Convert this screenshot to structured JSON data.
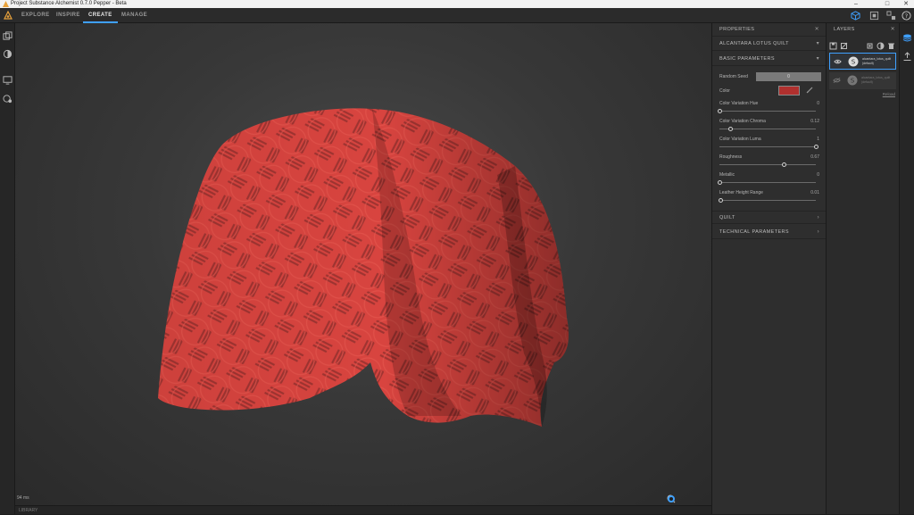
{
  "window": {
    "title": "Project Substance Alchemist 0.7.0 Pepper - Beta",
    "controls": [
      "–",
      "□",
      "✕"
    ]
  },
  "nav": {
    "tabs": [
      {
        "label": "EXPLORE",
        "active": false
      },
      {
        "label": "INSPIRE",
        "active": false
      },
      {
        "label": "CREATE",
        "active": true
      },
      {
        "label": "MANAGE",
        "active": false
      }
    ],
    "accent": "#3fa0ff"
  },
  "viewport": {
    "fps": "94 ms",
    "material_color": "#d8443f"
  },
  "library": {
    "label": "LIBRARY"
  },
  "properties": {
    "title": "PROPERTIES",
    "material_name": "ALCANTARA LOTUS QUILT",
    "sections": {
      "basic": "BASIC PARAMETERS",
      "quilt": "QUILT",
      "technical": "TECHNICAL PARAMETERS"
    },
    "random_seed": {
      "label": "Random Seed",
      "value": "0"
    },
    "color": {
      "label": "Color",
      "value": "#b0302e"
    },
    "sliders": [
      {
        "label": "Color Variation Hue",
        "value": "0",
        "fraction": 0.0
      },
      {
        "label": "Color Variation Chroma",
        "value": "0.12",
        "fraction": 0.12
      },
      {
        "label": "Color Variation Luma",
        "value": "1",
        "fraction": 1.0
      },
      {
        "label": "Roughness",
        "value": "0.67",
        "fraction": 0.67
      },
      {
        "label": "Metallic",
        "value": "0",
        "fraction": 0.0
      },
      {
        "label": "Leather Height Range",
        "value": "0.01",
        "fraction": 0.01
      }
    ]
  },
  "layers": {
    "title": "LAYERS",
    "items": [
      {
        "name": "alcantara_lotus_quilt (default)",
        "visible": true,
        "selected": true
      },
      {
        "name": "alcantara_lotus_quilt (default)",
        "visible": false,
        "selected": false
      }
    ],
    "reload": "Reload"
  }
}
